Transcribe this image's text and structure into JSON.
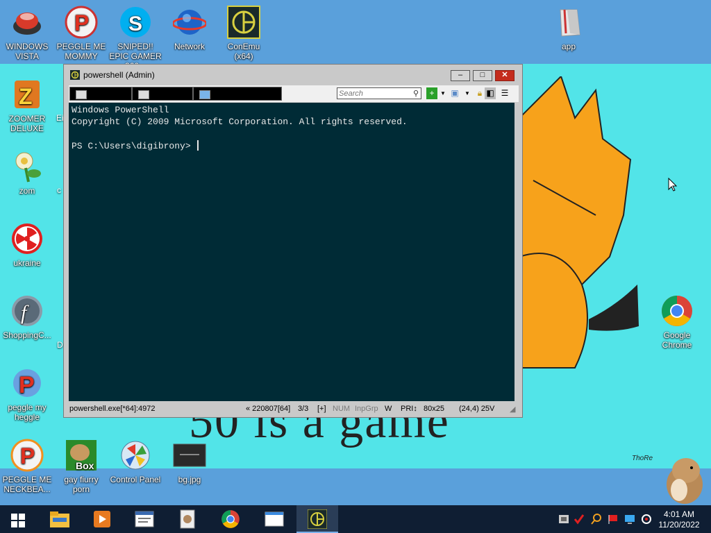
{
  "desktop": {
    "icons": [
      {
        "label": "WINDOWS VISTA",
        "icon": "vista-orb-icon"
      },
      {
        "label": "PEGGLE ME MOMMY",
        "icon": "peggle-icon"
      },
      {
        "label": "SNIPED!! EPIC GAMER 360...",
        "icon": "skype-icon"
      },
      {
        "label": "Network",
        "icon": "network-globe-icon"
      },
      {
        "label": "ConEmu (x64)",
        "icon": "conemu-icon"
      },
      {
        "label": "app",
        "icon": "app-icon"
      },
      {
        "label": "ZOOMER DELUXE",
        "icon": "zoomer-icon"
      },
      {
        "label": "zom",
        "icon": "zombie-flower-icon"
      },
      {
        "label": "ukraine",
        "icon": "radiation-icon"
      },
      {
        "label": "ShoppingC...",
        "icon": "flash-icon"
      },
      {
        "label": "peggle my heggle",
        "icon": "peggle-icon"
      },
      {
        "label": "PEGGLE ME NECKBEA...",
        "icon": "peggle-icon"
      },
      {
        "label": "gay fiurry porn",
        "icon": "box-hamster-icon"
      },
      {
        "label": "Control Panel",
        "icon": "control-panel-icon"
      },
      {
        "label": "bg.jpg",
        "icon": "image-file-icon"
      },
      {
        "label": "Google Chrome",
        "icon": "chrome-icon"
      }
    ],
    "partial_labels": [
      "Ei",
      "c",
      "D"
    ],
    "wallpaper_caption": "50 is a game",
    "wallpaper_signature": "ThoRe"
  },
  "window": {
    "title": "powershell (Admin)",
    "buttons": {
      "minimize": "–",
      "maximize": "□",
      "close": "✕"
    },
    "search_placeholder": "Search",
    "terminal_lines": [
      "Windows PowerShell",
      "Copyright (C) 2009 Microsoft Corporation. All rights reserved.",
      "",
      "PS C:\\Users\\digibrony> "
    ],
    "status": {
      "process": "powershell.exe[*64]:4972",
      "buffer": "« 220807[64]",
      "tabs": "3/3",
      "plus": "[+]",
      "num": "NUM",
      "inpgrp": "InpGrp",
      "w": "W",
      "pri": "PRI↕",
      "size": "80x25",
      "cursor": "(24,4) 25V"
    }
  },
  "taskbar": {
    "time": "4:01 AM",
    "date": "11/20/2022"
  },
  "colors": {
    "terminal_bg": "#002b36",
    "desktop_band": "#5aa0db",
    "wallpaper": "#52e4e8",
    "taskbar": "#0f1e33"
  }
}
